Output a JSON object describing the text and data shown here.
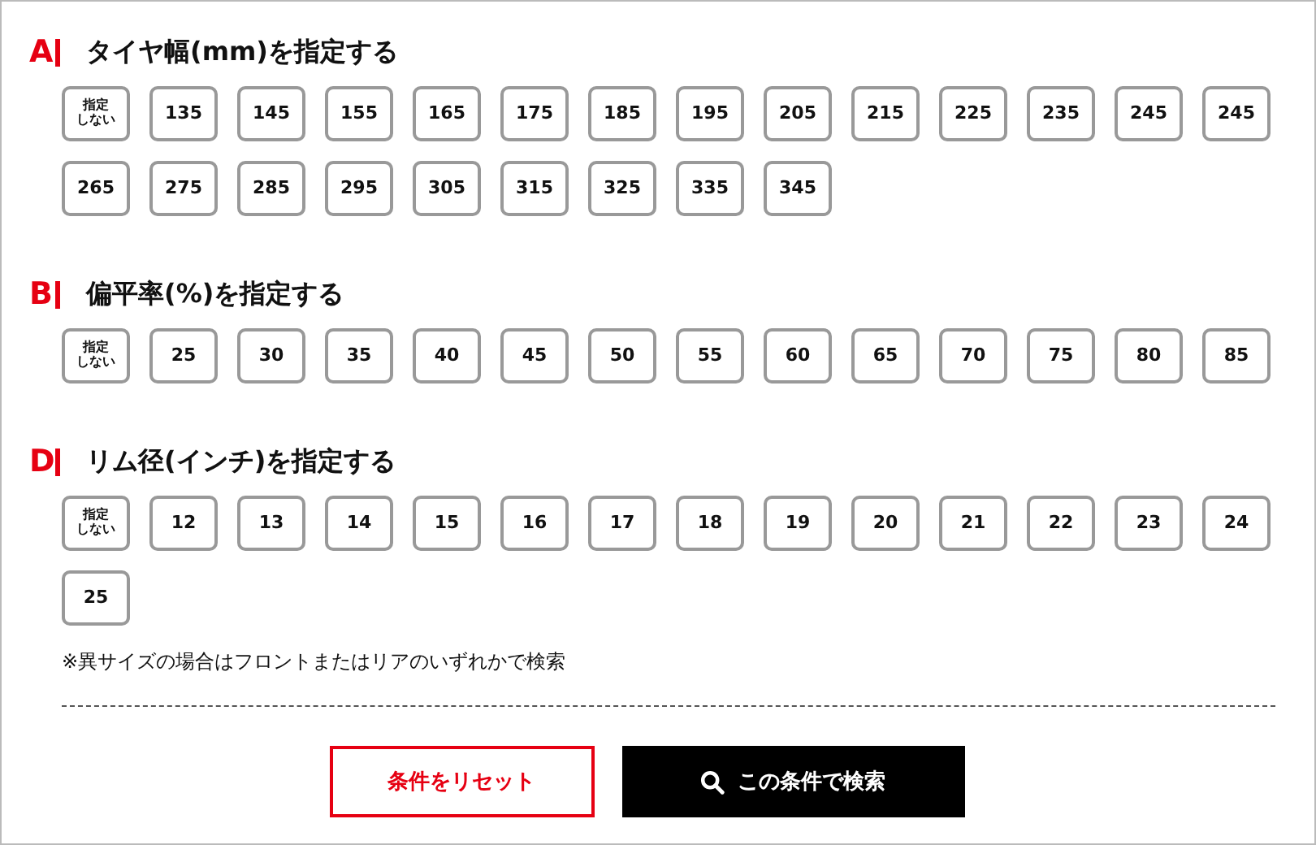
{
  "sections": [
    {
      "letter": "A",
      "title": "タイヤ幅(mm)を指定する",
      "options": [
        {
          "kind": "any",
          "lines": [
            "指定",
            "しない"
          ]
        },
        {
          "kind": "value",
          "label": "135"
        },
        {
          "kind": "value",
          "label": "145"
        },
        {
          "kind": "value",
          "label": "155"
        },
        {
          "kind": "value",
          "label": "165"
        },
        {
          "kind": "value",
          "label": "175"
        },
        {
          "kind": "value",
          "label": "185"
        },
        {
          "kind": "value",
          "label": "195"
        },
        {
          "kind": "value",
          "label": "205"
        },
        {
          "kind": "value",
          "label": "215"
        },
        {
          "kind": "value",
          "label": "225"
        },
        {
          "kind": "value",
          "label": "235"
        },
        {
          "kind": "value",
          "label": "245"
        },
        {
          "kind": "value",
          "label": "245"
        },
        {
          "kind": "value",
          "label": "265"
        },
        {
          "kind": "value",
          "label": "275"
        },
        {
          "kind": "value",
          "label": "285"
        },
        {
          "kind": "value",
          "label": "295"
        },
        {
          "kind": "value",
          "label": "305"
        },
        {
          "kind": "value",
          "label": "315"
        },
        {
          "kind": "value",
          "label": "325"
        },
        {
          "kind": "value",
          "label": "335"
        },
        {
          "kind": "value",
          "label": "345"
        }
      ]
    },
    {
      "letter": "B",
      "title": "偏平率(%)を指定する",
      "options": [
        {
          "kind": "any",
          "lines": [
            "指定",
            "しない"
          ]
        },
        {
          "kind": "value",
          "label": "25"
        },
        {
          "kind": "value",
          "label": "30"
        },
        {
          "kind": "value",
          "label": "35"
        },
        {
          "kind": "value",
          "label": "40"
        },
        {
          "kind": "value",
          "label": "45"
        },
        {
          "kind": "value",
          "label": "50"
        },
        {
          "kind": "value",
          "label": "55"
        },
        {
          "kind": "value",
          "label": "60"
        },
        {
          "kind": "value",
          "label": "65"
        },
        {
          "kind": "value",
          "label": "70"
        },
        {
          "kind": "value",
          "label": "75"
        },
        {
          "kind": "value",
          "label": "80"
        },
        {
          "kind": "value",
          "label": "85"
        }
      ]
    },
    {
      "letter": "D",
      "title": "リム径(インチ)を指定する",
      "options": [
        {
          "kind": "any",
          "lines": [
            "指定",
            "しない"
          ]
        },
        {
          "kind": "value",
          "label": "12"
        },
        {
          "kind": "value",
          "label": "13"
        },
        {
          "kind": "value",
          "label": "14"
        },
        {
          "kind": "value",
          "label": "15"
        },
        {
          "kind": "value",
          "label": "16"
        },
        {
          "kind": "value",
          "label": "17"
        },
        {
          "kind": "value",
          "label": "18"
        },
        {
          "kind": "value",
          "label": "19"
        },
        {
          "kind": "value",
          "label": "20"
        },
        {
          "kind": "value",
          "label": "21"
        },
        {
          "kind": "value",
          "label": "22"
        },
        {
          "kind": "value",
          "label": "23"
        },
        {
          "kind": "value",
          "label": "24"
        },
        {
          "kind": "value",
          "label": "25"
        }
      ]
    }
  ],
  "note": "※異サイズの場合はフロントまたはリアのいずれかで検索",
  "reset_button": "条件をリセット",
  "search_button": "この条件で検索"
}
